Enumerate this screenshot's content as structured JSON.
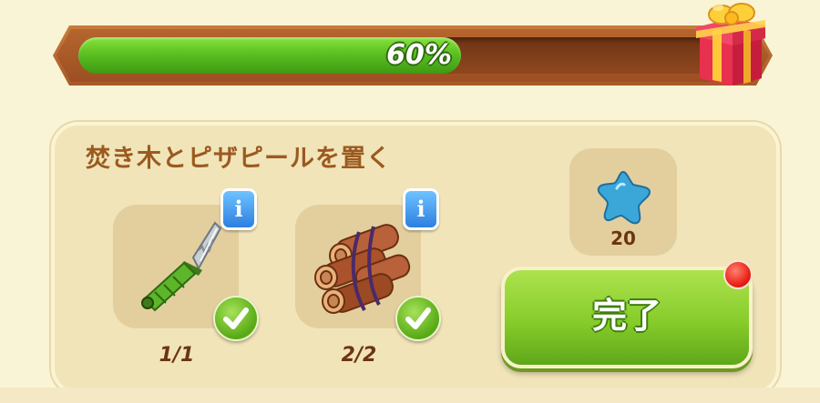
{
  "progress": {
    "label": "60%",
    "percent": 60,
    "fill_color": "#5cc022"
  },
  "gift_icon": "gift-box-icon",
  "task": {
    "title": "焚き木とピザピールを置く",
    "items": [
      {
        "icon": "knife-icon",
        "count": "1/1",
        "complete": true
      },
      {
        "icon": "firewood-bundle-icon",
        "count": "2/2",
        "complete": true
      }
    ],
    "reward": {
      "icon": "blue-star-icon",
      "amount": "20",
      "color": "#3aa7d8"
    },
    "complete_button": {
      "label": "完了",
      "color": "#86cc2a"
    },
    "info_label": "i"
  }
}
